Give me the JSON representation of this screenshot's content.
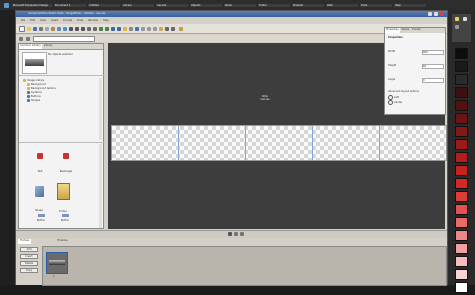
{
  "taskbar": {
    "tabs": [
      {
        "label": "Microsoft Expression Design"
      },
      {
        "label": "Document 1"
      },
      {
        "label": "Untitled"
      },
      {
        "label": "Library"
      },
      {
        "label": "Canvas"
      },
      {
        "label": "Objects"
      },
      {
        "label": "Panel"
      },
      {
        "label": "Folder"
      },
      {
        "label": "Browser"
      },
      {
        "label": "Web"
      },
      {
        "label": "Tools"
      },
      {
        "label": "Help"
      }
    ]
  },
  "app": {
    "title": "ComponentOne Studio Suite - ImageEditor - Untitled - Canvas",
    "menu": [
      "File",
      "Edit",
      "View",
      "Insert",
      "Format",
      "Tools",
      "Window",
      "Help"
    ],
    "tabs": [
      "Common Library",
      "Library",
      "Properties"
    ]
  },
  "library": {
    "header": "No objects selected",
    "tree_items": [
      "Image Library",
      "Background",
      "Background texture",
      "Symbols",
      "Buttons",
      "Shapes"
    ],
    "thumbs": [
      {
        "label": "Item"
      },
      {
        "label": "Item"
      },
      {
        "label": "Text",
        "kind": "text"
      },
      {
        "label": "Rectangle"
      },
      {
        "label": "Shape"
      },
      {
        "label": "Folder"
      },
      {
        "label": "Button"
      },
      {
        "label": "Button"
      }
    ]
  },
  "canvas": {
    "label_line1": "Strip",
    "label_line2": "Canvas"
  },
  "properties": {
    "tabs": [
      "Properties",
      "Styles",
      "Events"
    ],
    "header": "Properties",
    "rows": [
      {
        "name": "Width",
        "value": "800"
      },
      {
        "name": "Height",
        "value": "60"
      },
      {
        "name": "Angle",
        "value": "0"
      }
    ],
    "section": "Advanced layout options",
    "options": [
      "Left",
      "Center"
    ]
  },
  "bottom": {
    "tabs": [
      "Frames",
      "Timeline"
    ],
    "buttons": [
      "Add",
      "Insert",
      "Delete",
      "Copy"
    ],
    "frame_label": "1"
  },
  "swatches": [
    "#0c0c0c",
    "#1a1a1a",
    "#2b2b2b",
    "#3c1010",
    "#561010",
    "#6e1313",
    "#861717",
    "#9e1a1a",
    "#b51d1d",
    "#c92020",
    "#d62727",
    "#df3b3b",
    "#e55050",
    "#ea6a6a",
    "#ef8585",
    "#f3a0a0",
    "#f7bdbd",
    "#f8d4d4",
    "#ffffff"
  ]
}
